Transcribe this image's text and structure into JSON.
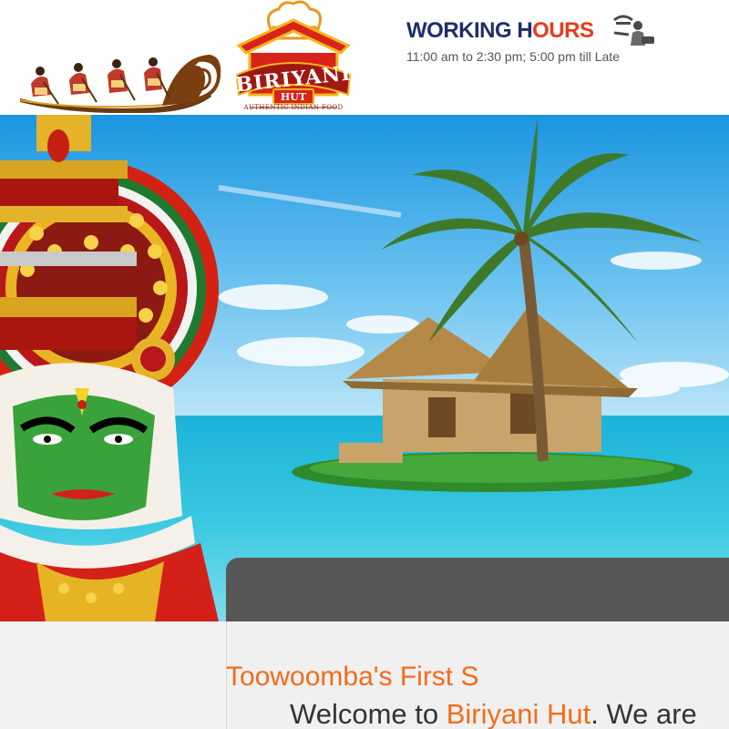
{
  "header": {
    "logo": {
      "name": "BIRIYANI",
      "badge": "HUT",
      "tagline": "AUTHENTIC INDIAN FOOD"
    },
    "boat_logo": "snake-boat-logo",
    "working_hours": {
      "title_start": "WORKING H",
      "title_accent": "OURS",
      "times": "11:00 am to 2:30 pm; 5:00 pm till Late",
      "icon": "chef-serving-icon"
    }
  },
  "hero": {
    "image": "kathakali-dancer-and-island-hut-banner"
  },
  "content": {
    "tagline": "Toowoomba's First S",
    "welcome_prefix": "Welcome to ",
    "welcome_brand": "Biriyani Hut",
    "welcome_suffix": ". We are"
  },
  "colors": {
    "accent_orange": "#f26c1a",
    "title_navy": "#1d2e6b",
    "title_red": "#e63c1e",
    "panel_dark": "#575757",
    "panel_light": "#f0f0f0"
  }
}
